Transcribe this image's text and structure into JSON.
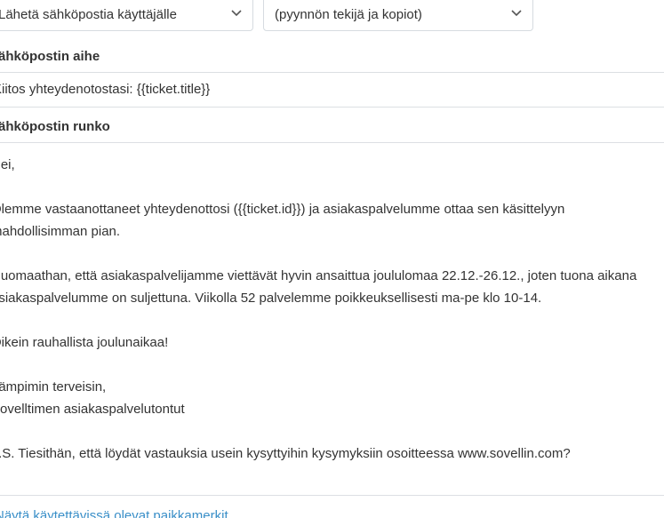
{
  "action_select": {
    "selected": "Lähetä sähköpostia käyttäjälle",
    "icon": "chevron-down-icon"
  },
  "recipients_select": {
    "selected": "(pyynnön tekijä ja kopiot)",
    "icon": "chevron-down-icon"
  },
  "subject": {
    "label": "Sähköpostin aihe",
    "value": "Kiitos yhteydenotostasi: {{ticket.title}}"
  },
  "body": {
    "label": "Sähköpostin runko",
    "lines": [
      "Hei,",
      "",
      "Olemme vastaanottaneet yhteydenottosi ({{ticket.id}}) ja asiakaspalvelumme ottaa sen käsittelyyn",
      "mahdollisimman pian.",
      "",
      "Huomaathan, että asiakaspalvelijamme viettävät hyvin ansaittua joululomaa  22.12.-26.12., joten tuona aikana",
      "asiakaspalvelumme on suljettuna. Viikolla 52 palvelemme poikkeuksellisesti ma-pe klo 10-14.",
      "",
      "Oikein rauhallista joulunaikaa!",
      "",
      "Lämpimin terveisin,",
      "Sovelltimen asiakaspalvelutontut",
      "",
      "P.S. Tiesithän, että löydät vastauksia usein kysyttyihin kysymyksiin osoitteessa www.sovellin.com?"
    ]
  },
  "placeholders_link": {
    "label": "Näytä käytettävissä olevat paikkamerkit"
  },
  "colors": {
    "link": "#3a8fc8",
    "border": "#d6dbe0",
    "divider": "#dcdfe3",
    "text": "#333333"
  }
}
